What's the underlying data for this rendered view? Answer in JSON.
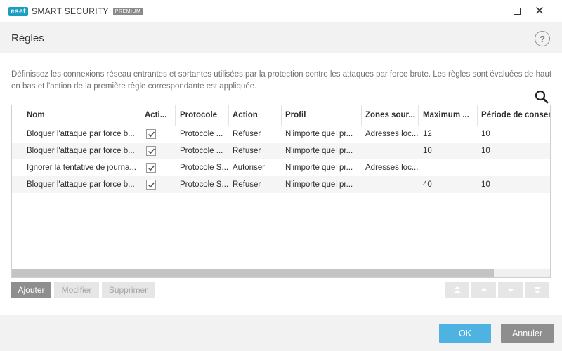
{
  "app": {
    "logo_badge": "eset",
    "product": "SMART SECURITY",
    "tier": "PREMIUM",
    "brand_color": "#1b9ec2"
  },
  "window": {
    "minimize_icon": "minimize-icon",
    "maximize_icon": "maximize-icon",
    "close_icon": "close-icon",
    "close_glyph": "✕"
  },
  "header": {
    "title": "Règles",
    "help_glyph": "?"
  },
  "description": "Définissez les connexions réseau entrantes et sortantes utilisées par la protection contre les attaques par force brute. Les règles sont évaluées de haut en bas et l'action de la première règle correspondante est appliquée.",
  "table": {
    "columns": [
      "Nom",
      "Acti...",
      "Protocole",
      "Action",
      "Profil",
      "Zones sour...",
      "Maximum ...",
      "Période de conser"
    ],
    "rows": [
      {
        "nom": "Bloquer l'attaque par force b...",
        "active": true,
        "protocole": "Protocole ...",
        "action": "Refuser",
        "profil": "N'importe quel pr...",
        "zones": "Adresses loc...",
        "maximum": "12",
        "periode": "10"
      },
      {
        "nom": "Bloquer l'attaque par force b...",
        "active": true,
        "protocole": "Protocole ...",
        "action": "Refuser",
        "profil": "N'importe quel pr...",
        "zones": "",
        "maximum": "10",
        "periode": "10"
      },
      {
        "nom": "Ignorer la tentative de journa...",
        "active": true,
        "protocole": "Protocole S...",
        "action": "Autoriser",
        "profil": "N'importe quel pr...",
        "zones": "Adresses loc...",
        "maximum": "",
        "periode": ""
      },
      {
        "nom": "Bloquer l'attaque par force b...",
        "active": true,
        "protocole": "Protocole S...",
        "action": "Refuser",
        "profil": "N'importe quel pr...",
        "zones": "",
        "maximum": "40",
        "periode": "10"
      }
    ]
  },
  "buttons": {
    "add": "Ajouter",
    "edit": "Modifier",
    "delete": "Supprimer",
    "ok": "OK",
    "cancel": "Annuler"
  },
  "colors": {
    "ok_button": "#4fb3e2",
    "neutral_button": "#8e8e8e"
  }
}
